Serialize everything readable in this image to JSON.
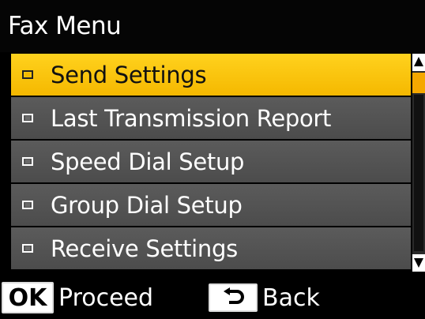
{
  "header": {
    "title": "Fax Menu"
  },
  "menu": {
    "items": [
      {
        "label": "Send Settings",
        "selected": true
      },
      {
        "label": "Last Transmission Report",
        "selected": false
      },
      {
        "label": "Speed Dial Setup",
        "selected": false
      },
      {
        "label": "Group Dial Setup",
        "selected": false
      },
      {
        "label": "Receive Settings",
        "selected": false
      }
    ]
  },
  "footer": {
    "ok_key_label": "OK",
    "proceed_label": "Proceed",
    "back_label": "Back",
    "back_icon": "return-arrow-icon"
  },
  "colors": {
    "selected_bg": "#f5b800",
    "item_bg": "#555555",
    "scroll_thumb": "#f5a800"
  }
}
